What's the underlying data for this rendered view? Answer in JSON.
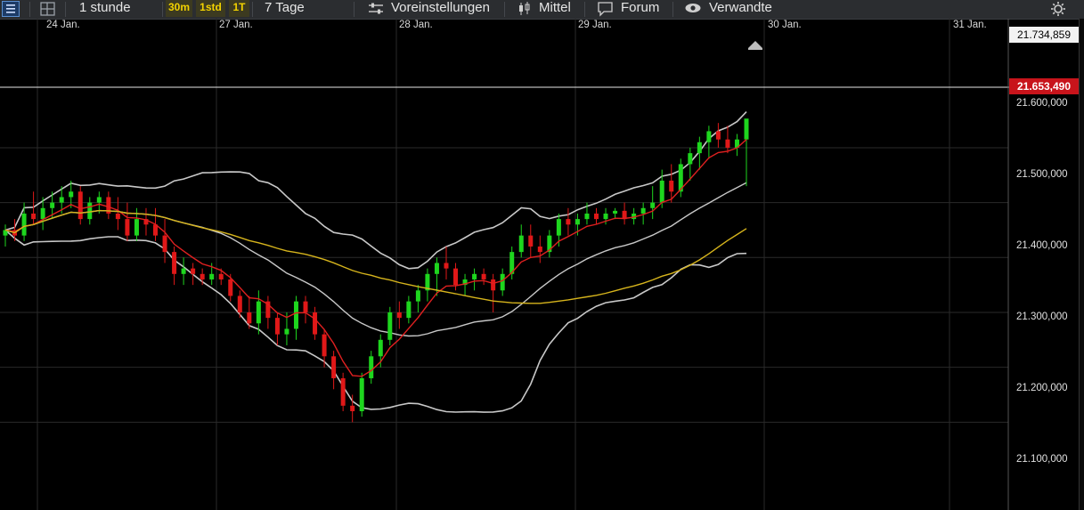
{
  "toolbar": {
    "interval_label": "1 stunde",
    "tf_30m": "30m",
    "tf_1std": "1std",
    "tf_1t": "1T",
    "range_label": "7 Tage",
    "settings_label": "Voreinstellungen",
    "indicator_label": "Mittel",
    "forum_label": "Forum",
    "related_label": "Verwandte"
  },
  "colors": {
    "up": "#1ed61e",
    "down": "#e01818",
    "ema_fast": "#e02020",
    "sma_slow": "#d6b41c",
    "bands": "#c8c8c8",
    "grid": "#2a2a2a"
  },
  "chart_data": {
    "type": "candlestick",
    "x_labels": [
      "24 Jan.",
      "27 Jan.",
      "28 Jan.",
      "29 Jan.",
      "30 Jan.",
      "31 Jan."
    ],
    "y_ticks": [
      "21.100,000",
      "21.200,000",
      "21.300,000",
      "21.400,000",
      "21.500,000",
      "21.600,000"
    ],
    "y_tick_values": [
      21100000,
      21200000,
      21300000,
      21400000,
      21500000,
      21600000
    ],
    "ylim": [
      20940000,
      21835000
    ],
    "top_value_label": "21.734,859",
    "current_price_label": "21.653,490",
    "current_price": 21653490,
    "grid": true,
    "candles": [
      [
        21440,
        21460,
        21420,
        21450
      ],
      [
        21450,
        21470,
        21430,
        21440
      ],
      [
        21440,
        21500,
        21430,
        21480
      ],
      [
        21480,
        21520,
        21460,
        21470
      ],
      [
        21470,
        21510,
        21450,
        21490
      ],
      [
        21490,
        21520,
        21470,
        21500
      ],
      [
        21500,
        21530,
        21480,
        21510
      ],
      [
        21510,
        21540,
        21490,
        21520
      ],
      [
        21520,
        21530,
        21460,
        21470
      ],
      [
        21470,
        21510,
        21460,
        21500
      ],
      [
        21500,
        21520,
        21480,
        21510
      ],
      [
        21510,
        21520,
        21470,
        21480
      ],
      [
        21480,
        21510,
        21450,
        21470
      ],
      [
        21470,
        21500,
        21430,
        21440
      ],
      [
        21440,
        21490,
        21430,
        21470
      ],
      [
        21470,
        21490,
        21440,
        21460
      ],
      [
        21460,
        21490,
        21430,
        21440
      ],
      [
        21440,
        21470,
        21390,
        21410
      ],
      [
        21410,
        21420,
        21350,
        21370
      ],
      [
        21370,
        21400,
        21350,
        21380
      ],
      [
        21380,
        21390,
        21350,
        21370
      ],
      [
        21370,
        21380,
        21350,
        21360
      ],
      [
        21360,
        21390,
        21350,
        21370
      ],
      [
        21370,
        21380,
        21350,
        21360
      ],
      [
        21360,
        21370,
        21320,
        21330
      ],
      [
        21330,
        21340,
        21290,
        21300
      ],
      [
        21300,
        21330,
        21270,
        21280
      ],
      [
        21280,
        21340,
        21260,
        21320
      ],
      [
        21320,
        21330,
        21270,
        21290
      ],
      [
        21290,
        21300,
        21240,
        21260
      ],
      [
        21260,
        21300,
        21240,
        21270
      ],
      [
        21270,
        21330,
        21250,
        21320
      ],
      [
        21320,
        21330,
        21280,
        21300
      ],
      [
        21300,
        21310,
        21250,
        21260
      ],
      [
        21260,
        21270,
        21200,
        21220
      ],
      [
        21220,
        21230,
        21160,
        21180
      ],
      [
        21180,
        21190,
        21120,
        21130
      ],
      [
        21130,
        21150,
        21100,
        21120
      ],
      [
        21120,
        21190,
        21110,
        21180
      ],
      [
        21180,
        21230,
        21170,
        21220
      ],
      [
        21220,
        21260,
        21200,
        21250
      ],
      [
        21250,
        21310,
        21240,
        21300
      ],
      [
        21300,
        21320,
        21270,
        21290
      ],
      [
        21290,
        21330,
        21280,
        21320
      ],
      [
        21320,
        21350,
        21300,
        21340
      ],
      [
        21340,
        21380,
        21320,
        21370
      ],
      [
        21370,
        21400,
        21330,
        21390
      ],
      [
        21390,
        21420,
        21360,
        21380
      ],
      [
        21380,
        21390,
        21340,
        21350
      ],
      [
        21350,
        21370,
        21330,
        21360
      ],
      [
        21360,
        21380,
        21340,
        21370
      ],
      [
        21370,
        21380,
        21350,
        21360
      ],
      [
        21360,
        21370,
        21300,
        21340
      ],
      [
        21340,
        21380,
        21330,
        21370
      ],
      [
        21370,
        21420,
        21360,
        21410
      ],
      [
        21410,
        21460,
        21400,
        21440
      ],
      [
        21440,
        21460,
        21400,
        21420
      ],
      [
        21420,
        21440,
        21390,
        21410
      ],
      [
        21410,
        21450,
        21400,
        21440
      ],
      [
        21440,
        21480,
        21420,
        21470
      ],
      [
        21470,
        21490,
        21440,
        21460
      ],
      [
        21460,
        21480,
        21440,
        21470
      ],
      [
        21470,
        21500,
        21460,
        21480
      ],
      [
        21480,
        21490,
        21460,
        21470
      ],
      [
        21470,
        21490,
        21460,
        21480
      ],
      [
        21480,
        21490,
        21470,
        21485
      ],
      [
        21485,
        21500,
        21460,
        21470
      ],
      [
        21470,
        21490,
        21460,
        21480
      ],
      [
        21480,
        21500,
        21460,
        21490
      ],
      [
        21490,
        21530,
        21470,
        21500
      ],
      [
        21500,
        21560,
        21490,
        21540
      ],
      [
        21540,
        21570,
        21500,
        21520
      ],
      [
        21520,
        21580,
        21510,
        21570
      ],
      [
        21570,
        21600,
        21540,
        21590
      ],
      [
        21590,
        21620,
        21560,
        21610
      ],
      [
        21610,
        21640,
        21580,
        21630
      ],
      [
        21630,
        21645,
        21600,
        21615
      ],
      [
        21615,
        21640,
        21590,
        21600
      ],
      [
        21600,
        21625,
        21585,
        21615
      ],
      [
        21615,
        21645,
        21530,
        21653
      ]
    ]
  }
}
